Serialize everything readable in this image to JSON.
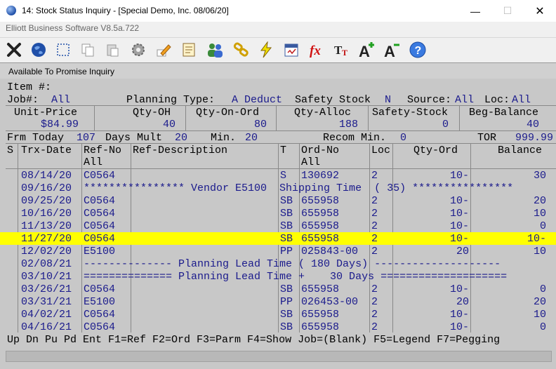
{
  "window": {
    "title": "14: Stock Status Inquiry - [Special Demo, Inc. 08/06/20]",
    "subtitle": "Elliott Business Software V8.5a.722",
    "min_glyph": "—",
    "max_glyph": "☐",
    "close_glyph": "✕"
  },
  "toolbar": {
    "icons": [
      "exit-icon",
      "globe-icon",
      "select-icon",
      "copy-icon",
      "paste-icon",
      "settings-icon",
      "edit-icon",
      "notes-icon",
      "users-icon",
      "link-icon",
      "lightning-icon",
      "calendar-icon",
      "fx-icon",
      "font-size-icon",
      "font-increase-icon",
      "font-decrease-icon",
      "help-icon"
    ]
  },
  "panel": {
    "title": "Available To Promise Inquiry"
  },
  "header": {
    "item_label": "Item #:",
    "job_label": "Job#:",
    "job_value": "All",
    "planning_type_label": "Planning Type:",
    "planning_type_value": "A Deduct",
    "safety_stock_label": "Safety Stock",
    "safety_stock_value": "N",
    "source_label": "Source:",
    "source_value": "All",
    "loc_label": "Loc:",
    "loc_value": "All"
  },
  "summary": {
    "unit_price_label": "Unit-Price",
    "unit_price_value": "$84.99",
    "qty_oh_label": "Qty-OH",
    "qty_oh_value": "40",
    "qty_on_ord_label": "Qty-On-Ord",
    "qty_on_ord_value": "80",
    "qty_alloc_label": "Qty-Alloc",
    "qty_alloc_value": "188",
    "safety_stock_label": "Safety-Stock",
    "safety_stock_value": "0",
    "beg_balance_label": "Beg-Balance",
    "beg_balance_value": "40"
  },
  "params": {
    "frm_today_label": "Frm Today",
    "frm_today_value": "107",
    "days_mult_label": "Days Mult",
    "days_mult_value": "20",
    "min_label": "Min.",
    "min_value": "20",
    "recom_min_label": "Recom Min.",
    "recom_min_value": "0",
    "tor_label": "TOR",
    "tor_value": "999.99"
  },
  "columns": {
    "s": "S",
    "trx_date": "Trx-Date",
    "ref_no": "Ref-No",
    "ref_no_filter": "All",
    "ref_description": "Ref-Description",
    "t": "T",
    "ord_no": "Ord-No",
    "ord_no_filter": "All",
    "loc": "Loc",
    "qty_ord": "Qty-Ord",
    "balance": "Balance"
  },
  "rows": [
    {
      "date": "08/14/20",
      "ref": "C0564",
      "t": "S",
      "ord": "130692",
      "loc": "2",
      "qty": "10-",
      "bal": "30"
    },
    {
      "date": "09/16/20",
      "text": "**************** Vendor E5100  Shipping Time  ( 35) ****************"
    },
    {
      "date": "09/25/20",
      "ref": "C0564",
      "t": "SB",
      "ord": "655958",
      "loc": "2",
      "qty": "10-",
      "bal": "20"
    },
    {
      "date": "10/16/20",
      "ref": "C0564",
      "t": "SB",
      "ord": "655958",
      "loc": "2",
      "qty": "10-",
      "bal": "10"
    },
    {
      "date": "11/13/20",
      "ref": "C0564",
      "t": "SB",
      "ord": "655958",
      "loc": "2",
      "qty": "10-",
      "bal": "0"
    },
    {
      "date": "11/27/20",
      "ref": "C0564",
      "t": "SB",
      "ord": "655958",
      "loc": "2",
      "qty": "10-",
      "bal": "10-",
      "selected": true
    },
    {
      "date": "12/02/20",
      "ref": "E5100",
      "t": "PP",
      "ord": "025843-00",
      "loc": "2",
      "qty": "20",
      "bal": "10"
    },
    {
      "date": "02/08/21",
      "text": "-------------- Planning Lead Time ( 180 Days) --------------------"
    },
    {
      "date": "03/10/21",
      "text": "============== Planning Lead Time +    30 Days ===================="
    },
    {
      "date": "03/26/21",
      "ref": "C0564",
      "t": "SB",
      "ord": "655958",
      "loc": "2",
      "qty": "10-",
      "bal": "0"
    },
    {
      "date": "03/31/21",
      "ref": "E5100",
      "t": "PP",
      "ord": "026453-00",
      "loc": "2",
      "qty": "20",
      "bal": "20"
    },
    {
      "date": "04/02/21",
      "ref": "C0564",
      "t": "SB",
      "ord": "655958",
      "loc": "2",
      "qty": "10-",
      "bal": "10"
    },
    {
      "date": "04/16/21",
      "ref": "C0564",
      "t": "SB",
      "ord": "655958",
      "loc": "2",
      "qty": "10-",
      "bal": "0"
    }
  ],
  "footer": {
    "keys": "Up Dn Pu Pd Ent F1=Ref F2=Ord F3=Parm F4=Show Job=(Blank) F5=Legend F7=Pegging"
  }
}
